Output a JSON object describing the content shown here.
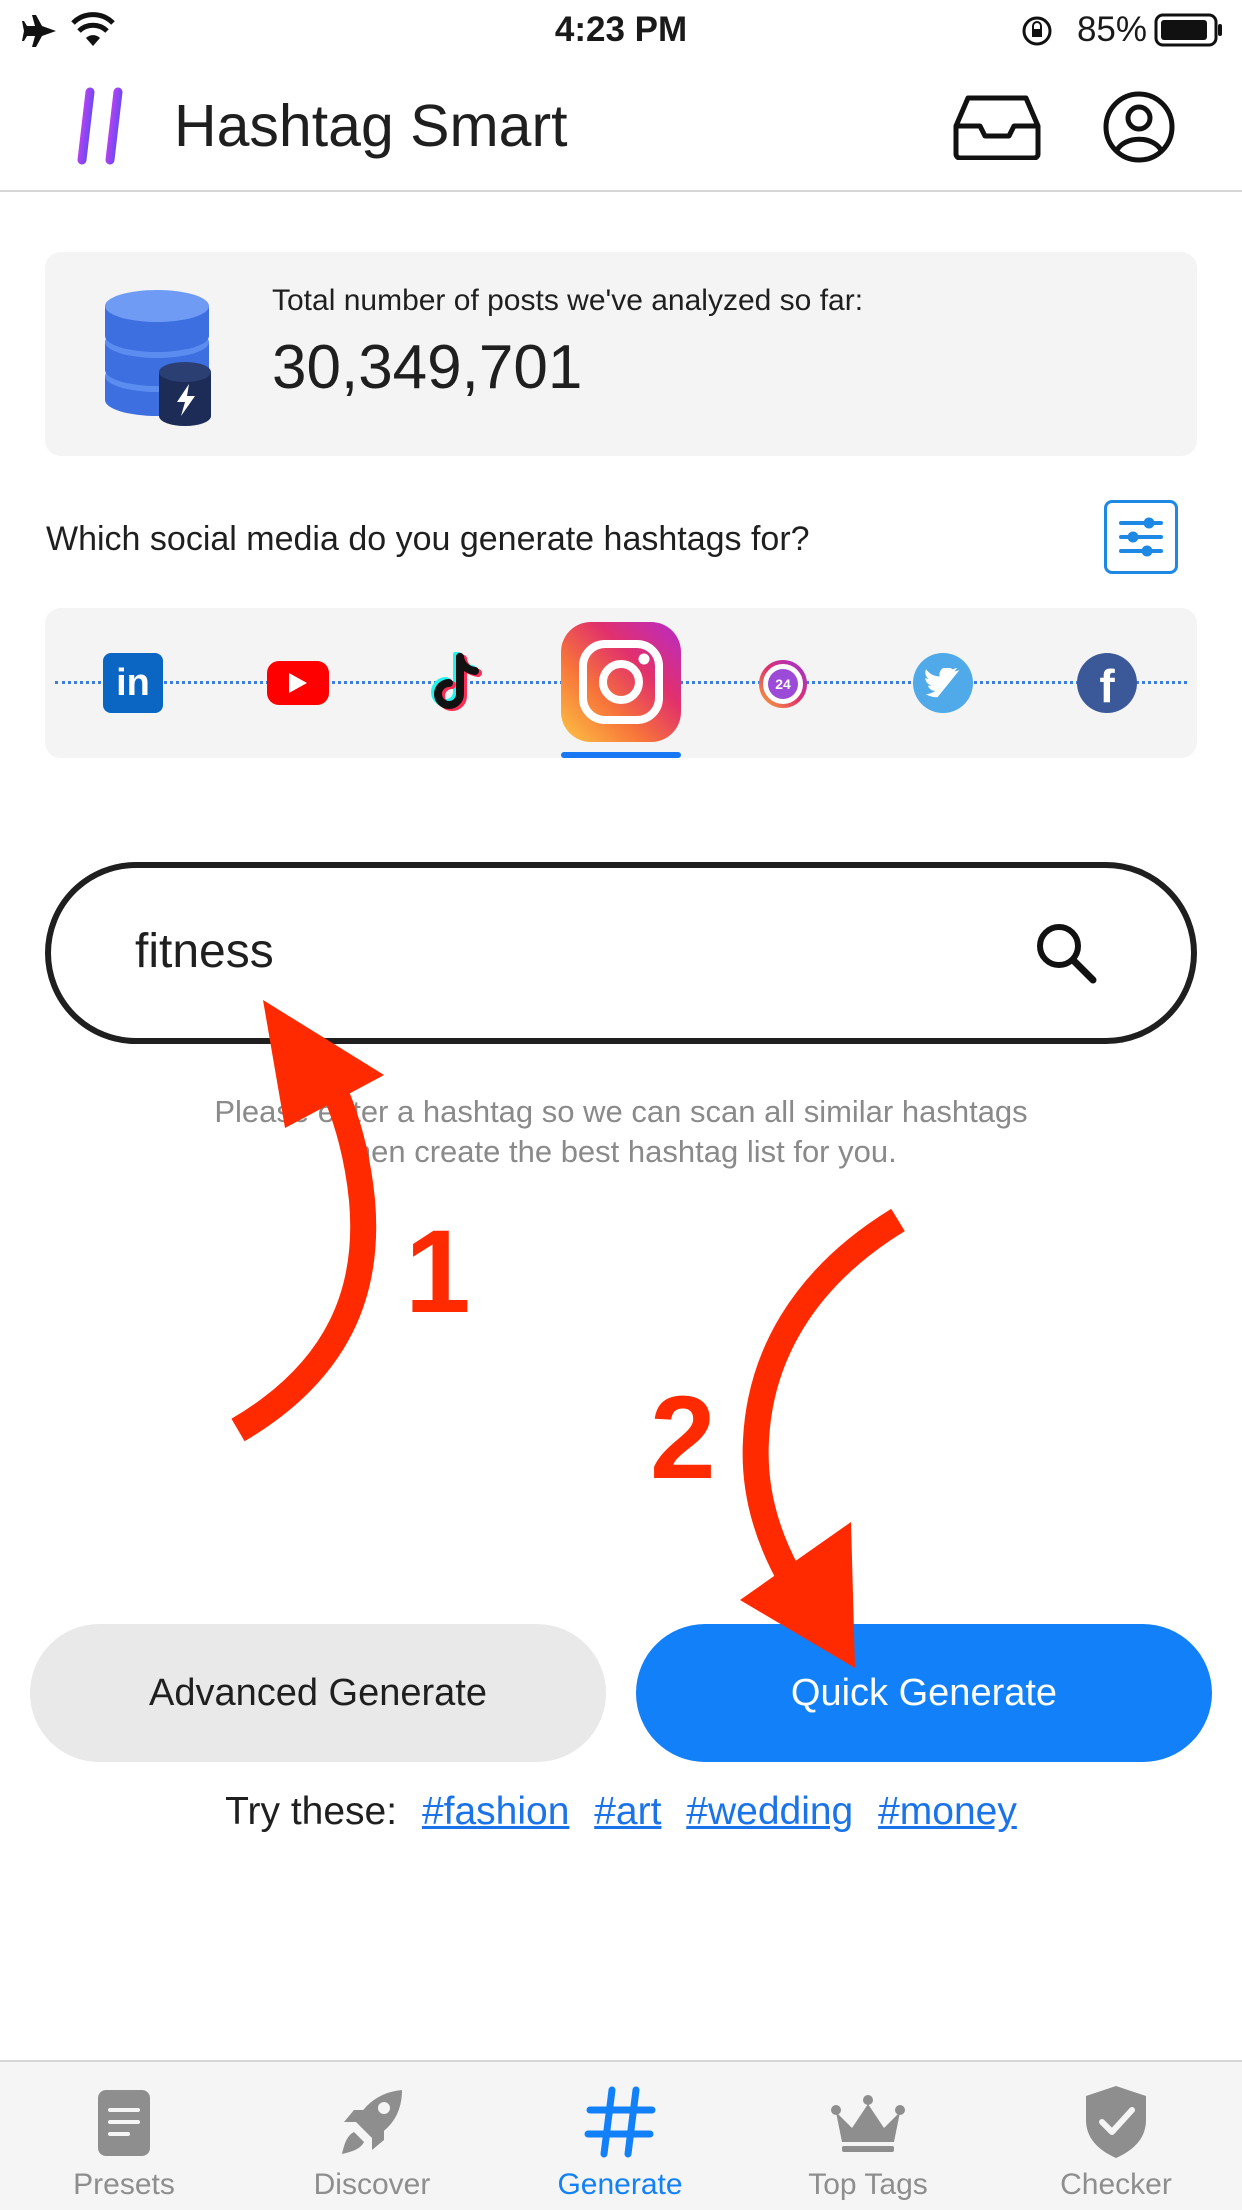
{
  "status_bar": {
    "time": "4:23 PM",
    "battery_percent": "85%"
  },
  "header": {
    "title": "Hashtag Smart"
  },
  "stats": {
    "label": "Total number of posts we've analyzed so far:",
    "value": "30,349,701"
  },
  "platform_question": "Which social media do you generate hashtags for?",
  "platforms": {
    "items": [
      "linkedin",
      "youtube",
      "tiktok",
      "instagram",
      "instagram-24",
      "twitter",
      "facebook"
    ],
    "selected": "instagram"
  },
  "search": {
    "value": "fitness"
  },
  "hint": {
    "line1": "Please enter a hashtag so we can scan all similar hashtags",
    "line2": "then create the best hashtag list for you."
  },
  "buttons": {
    "advanced": "Advanced Generate",
    "quick": "Quick Generate"
  },
  "suggestions": {
    "label": "Try these:",
    "tags": [
      "#fashion",
      "#art",
      "#wedding",
      "#money"
    ]
  },
  "annotations": {
    "step1": "1",
    "step2": "2"
  },
  "tabs": [
    {
      "label": "Presets",
      "icon": "document-icon"
    },
    {
      "label": "Discover",
      "icon": "rocket-icon"
    },
    {
      "label": "Generate",
      "icon": "hashtag-icon"
    },
    {
      "label": "Top Tags",
      "icon": "crown-icon"
    },
    {
      "label": "Checker",
      "icon": "shield-check-icon"
    }
  ],
  "colors": {
    "accent": "#1281f9",
    "annotation_red": "#ff2a00"
  }
}
